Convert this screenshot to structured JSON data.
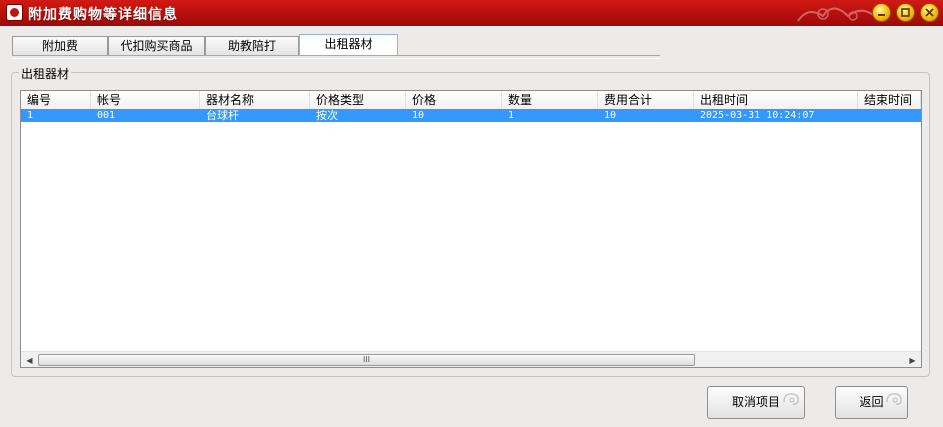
{
  "window": {
    "title": "附加费购物等详细信息"
  },
  "tabs": [
    {
      "label": "附加费"
    },
    {
      "label": "代扣购买商品"
    },
    {
      "label": "助教陪打"
    },
    {
      "label": "出租器材"
    }
  ],
  "active_tab": "出租器材",
  "group": {
    "label": "出租器材"
  },
  "table": {
    "columns": [
      "编号",
      "帐号",
      "器材名称",
      "价格类型",
      "价格",
      "数量",
      "费用合计",
      "出租时间",
      "结束时间"
    ],
    "rows": [
      [
        "1",
        "001",
        "台球杆",
        "按次",
        "10",
        "1",
        "10",
        "2025-03-31 10:24:07",
        ""
      ]
    ],
    "selected_row": 0
  },
  "scrollbar": {
    "thumb_label": "III"
  },
  "buttons": {
    "cancel_item": "取消项目",
    "back": "返回"
  },
  "colors": {
    "titlebar": "#c0150f",
    "selection": "#3399ff"
  },
  "icons": {
    "app": "app-logo-icon",
    "minimize": "minimize-icon",
    "restore": "restore-icon",
    "close": "close-icon"
  }
}
